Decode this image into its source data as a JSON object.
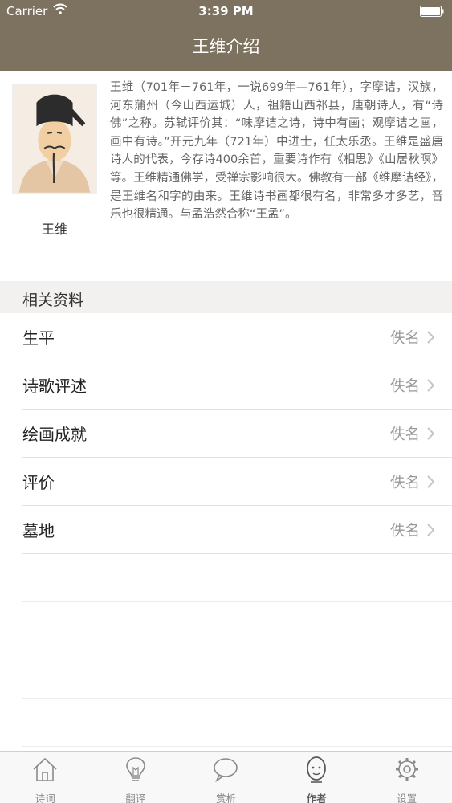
{
  "status_bar": {
    "carrier": "Carrier",
    "time": "3:39 PM"
  },
  "nav": {
    "title": "王维介绍"
  },
  "author": {
    "name": "王维",
    "bio": "王维（701年－761年，一说699年—761年），字摩诘，汉族，河东蒲州（今山西运城）人，祖籍山西祁县，唐朝诗人，有“诗佛”之称。苏轼评价其：“味摩诘之诗，诗中有画；观摩诘之画，画中有诗。”开元九年（721年）中进士，任太乐丞。王维是盛唐诗人的代表，今存诗400余首，重要诗作有《相思》《山居秋暝》等。王维精通佛学，受禅宗影响很大。佛教有一部《维摩诘经》，是王维名和字的由来。王维诗书画都很有名，非常多才多艺，音乐也很精通。与孟浩然合称“王孟”。"
  },
  "section": {
    "title": "相关资料"
  },
  "rows": [
    {
      "label": "生平",
      "value": "佚名"
    },
    {
      "label": "诗歌评述",
      "value": "佚名"
    },
    {
      "label": "绘画成就",
      "value": "佚名"
    },
    {
      "label": "评价",
      "value": "佚名"
    },
    {
      "label": "墓地",
      "value": "佚名"
    }
  ],
  "tabs": [
    {
      "label": "诗词",
      "icon": "house-icon"
    },
    {
      "label": "翻译",
      "icon": "lightbulb-icon"
    },
    {
      "label": "赏析",
      "icon": "speech-bubble-icon"
    },
    {
      "label": "作者",
      "icon": "head-icon",
      "active": true
    },
    {
      "label": "设置",
      "icon": "gear-icon"
    }
  ],
  "colors": {
    "nav_bg": "#7d7260",
    "section_bg": "#f2f1f0",
    "tab_bg": "#f8f8f8"
  }
}
